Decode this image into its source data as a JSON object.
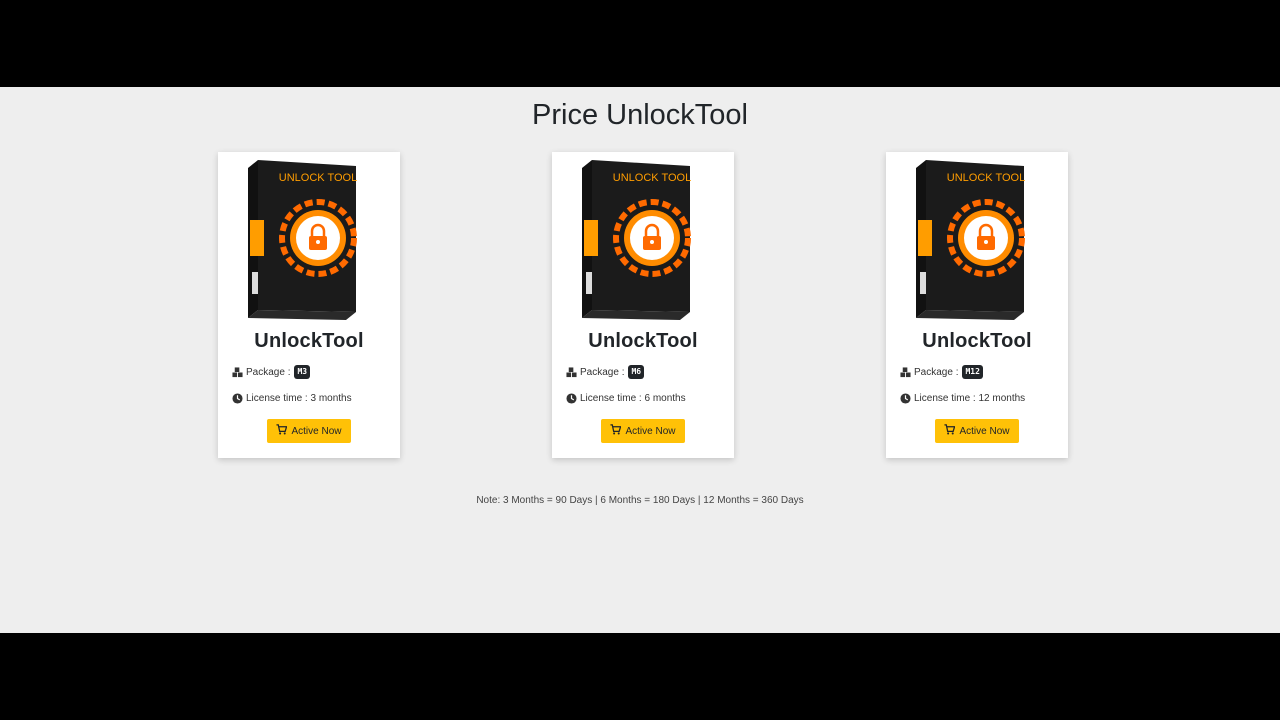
{
  "page": {
    "title": "Price UnlockTool"
  },
  "products": [
    {
      "name": "UnlockTool",
      "box_label": "UNLOCK TOOL",
      "package_label": "Package :",
      "package_code": "M3",
      "license_text": "License time : 3 months",
      "button_label": "Active Now"
    },
    {
      "name": "UnlockTool",
      "box_label": "UNLOCK TOOL",
      "package_label": "Package :",
      "package_code": "M6",
      "license_text": "License time : 6 months",
      "button_label": "Active Now"
    },
    {
      "name": "UnlockTool",
      "box_label": "UNLOCK TOOL",
      "package_label": "Package :",
      "package_code": "M12",
      "license_text": "License time : 12 months",
      "button_label": "Active Now"
    }
  ],
  "note": "Note: 3 Months = 90 Days | 6 Months = 180 Days | 12 Months = 360 Days",
  "colors": {
    "accent": "#ffc107",
    "badge": "#212529",
    "box_orange": "#ff8c00",
    "page_bg": "#eeeeee"
  },
  "icons": {
    "package": "cubes-icon",
    "license": "clock-icon",
    "button": "cart-icon",
    "box": "lock-icon"
  }
}
